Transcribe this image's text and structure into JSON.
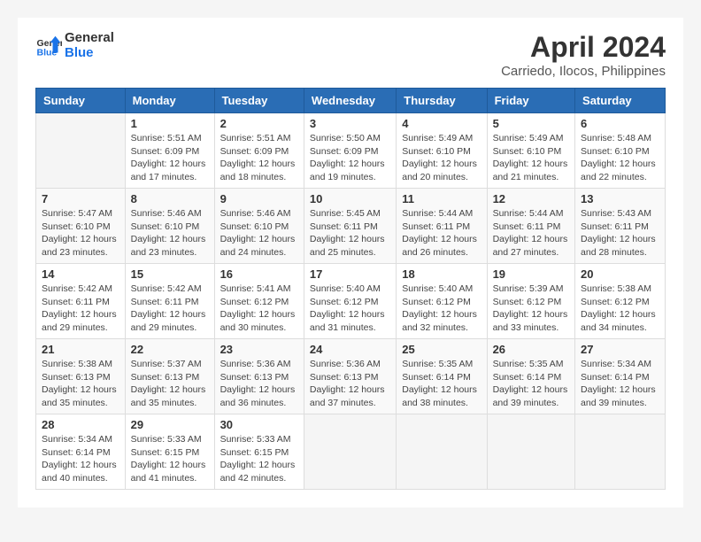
{
  "header": {
    "logo_line1": "General",
    "logo_line2": "Blue",
    "month_year": "April 2024",
    "location": "Carriedo, Ilocos, Philippines"
  },
  "weekdays": [
    "Sunday",
    "Monday",
    "Tuesday",
    "Wednesday",
    "Thursday",
    "Friday",
    "Saturday"
  ],
  "weeks": [
    [
      {
        "day": "",
        "info": ""
      },
      {
        "day": "1",
        "info": "Sunrise: 5:51 AM\nSunset: 6:09 PM\nDaylight: 12 hours\nand 17 minutes."
      },
      {
        "day": "2",
        "info": "Sunrise: 5:51 AM\nSunset: 6:09 PM\nDaylight: 12 hours\nand 18 minutes."
      },
      {
        "day": "3",
        "info": "Sunrise: 5:50 AM\nSunset: 6:09 PM\nDaylight: 12 hours\nand 19 minutes."
      },
      {
        "day": "4",
        "info": "Sunrise: 5:49 AM\nSunset: 6:10 PM\nDaylight: 12 hours\nand 20 minutes."
      },
      {
        "day": "5",
        "info": "Sunrise: 5:49 AM\nSunset: 6:10 PM\nDaylight: 12 hours\nand 21 minutes."
      },
      {
        "day": "6",
        "info": "Sunrise: 5:48 AM\nSunset: 6:10 PM\nDaylight: 12 hours\nand 22 minutes."
      }
    ],
    [
      {
        "day": "7",
        "info": "Sunrise: 5:47 AM\nSunset: 6:10 PM\nDaylight: 12 hours\nand 23 minutes."
      },
      {
        "day": "8",
        "info": "Sunrise: 5:46 AM\nSunset: 6:10 PM\nDaylight: 12 hours\nand 23 minutes."
      },
      {
        "day": "9",
        "info": "Sunrise: 5:46 AM\nSunset: 6:10 PM\nDaylight: 12 hours\nand 24 minutes."
      },
      {
        "day": "10",
        "info": "Sunrise: 5:45 AM\nSunset: 6:11 PM\nDaylight: 12 hours\nand 25 minutes."
      },
      {
        "day": "11",
        "info": "Sunrise: 5:44 AM\nSunset: 6:11 PM\nDaylight: 12 hours\nand 26 minutes."
      },
      {
        "day": "12",
        "info": "Sunrise: 5:44 AM\nSunset: 6:11 PM\nDaylight: 12 hours\nand 27 minutes."
      },
      {
        "day": "13",
        "info": "Sunrise: 5:43 AM\nSunset: 6:11 PM\nDaylight: 12 hours\nand 28 minutes."
      }
    ],
    [
      {
        "day": "14",
        "info": "Sunrise: 5:42 AM\nSunset: 6:11 PM\nDaylight: 12 hours\nand 29 minutes."
      },
      {
        "day": "15",
        "info": "Sunrise: 5:42 AM\nSunset: 6:11 PM\nDaylight: 12 hours\nand 29 minutes."
      },
      {
        "day": "16",
        "info": "Sunrise: 5:41 AM\nSunset: 6:12 PM\nDaylight: 12 hours\nand 30 minutes."
      },
      {
        "day": "17",
        "info": "Sunrise: 5:40 AM\nSunset: 6:12 PM\nDaylight: 12 hours\nand 31 minutes."
      },
      {
        "day": "18",
        "info": "Sunrise: 5:40 AM\nSunset: 6:12 PM\nDaylight: 12 hours\nand 32 minutes."
      },
      {
        "day": "19",
        "info": "Sunrise: 5:39 AM\nSunset: 6:12 PM\nDaylight: 12 hours\nand 33 minutes."
      },
      {
        "day": "20",
        "info": "Sunrise: 5:38 AM\nSunset: 6:12 PM\nDaylight: 12 hours\nand 34 minutes."
      }
    ],
    [
      {
        "day": "21",
        "info": "Sunrise: 5:38 AM\nSunset: 6:13 PM\nDaylight: 12 hours\nand 35 minutes."
      },
      {
        "day": "22",
        "info": "Sunrise: 5:37 AM\nSunset: 6:13 PM\nDaylight: 12 hours\nand 35 minutes."
      },
      {
        "day": "23",
        "info": "Sunrise: 5:36 AM\nSunset: 6:13 PM\nDaylight: 12 hours\nand 36 minutes."
      },
      {
        "day": "24",
        "info": "Sunrise: 5:36 AM\nSunset: 6:13 PM\nDaylight: 12 hours\nand 37 minutes."
      },
      {
        "day": "25",
        "info": "Sunrise: 5:35 AM\nSunset: 6:14 PM\nDaylight: 12 hours\nand 38 minutes."
      },
      {
        "day": "26",
        "info": "Sunrise: 5:35 AM\nSunset: 6:14 PM\nDaylight: 12 hours\nand 39 minutes."
      },
      {
        "day": "27",
        "info": "Sunrise: 5:34 AM\nSunset: 6:14 PM\nDaylight: 12 hours\nand 39 minutes."
      }
    ],
    [
      {
        "day": "28",
        "info": "Sunrise: 5:34 AM\nSunset: 6:14 PM\nDaylight: 12 hours\nand 40 minutes."
      },
      {
        "day": "29",
        "info": "Sunrise: 5:33 AM\nSunset: 6:15 PM\nDaylight: 12 hours\nand 41 minutes."
      },
      {
        "day": "30",
        "info": "Sunrise: 5:33 AM\nSunset: 6:15 PM\nDaylight: 12 hours\nand 42 minutes."
      },
      {
        "day": "",
        "info": ""
      },
      {
        "day": "",
        "info": ""
      },
      {
        "day": "",
        "info": ""
      },
      {
        "day": "",
        "info": ""
      }
    ]
  ]
}
